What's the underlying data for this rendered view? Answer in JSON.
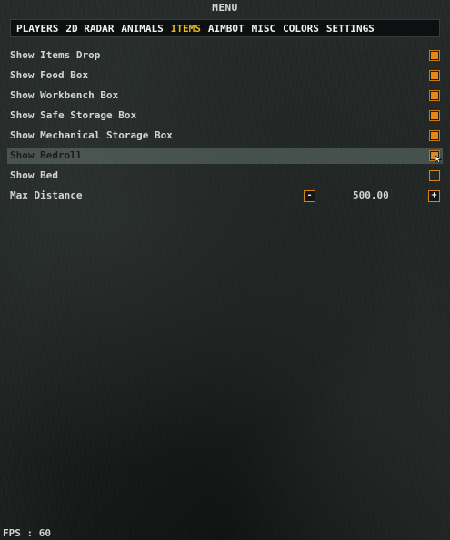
{
  "menu": {
    "title": "MENU"
  },
  "tabs": [
    {
      "label": "PLAYERS",
      "active": false
    },
    {
      "label": "2D RADAR",
      "active": false
    },
    {
      "label": "ANIMALS",
      "active": false
    },
    {
      "label": "ITEMS",
      "active": true
    },
    {
      "label": "AIMBOT",
      "active": false
    },
    {
      "label": "MISC",
      "active": false
    },
    {
      "label": "COLORS",
      "active": false
    },
    {
      "label": "SETTINGS",
      "active": false
    }
  ],
  "options": [
    {
      "label": "Show Items Drop",
      "checked": true
    },
    {
      "label": "Show Food Box",
      "checked": true
    },
    {
      "label": "Show Workbench Box",
      "checked": true
    },
    {
      "label": "Show Safe Storage Box",
      "checked": true
    },
    {
      "label": "Show Mechanical Storage Box",
      "checked": true
    },
    {
      "label": "Show Bedroll",
      "checked": true,
      "hovered": true
    },
    {
      "label": "Show Bed",
      "checked": false
    }
  ],
  "max_distance": {
    "label": "Max Distance",
    "minus_label": "-",
    "plus_label": "+",
    "value": "500.00"
  },
  "status": {
    "fps": "FPS : 60"
  },
  "colors": {
    "accent": "#e8861a",
    "active_tab": "#f0b818",
    "hover_row": "#6f7d76"
  }
}
